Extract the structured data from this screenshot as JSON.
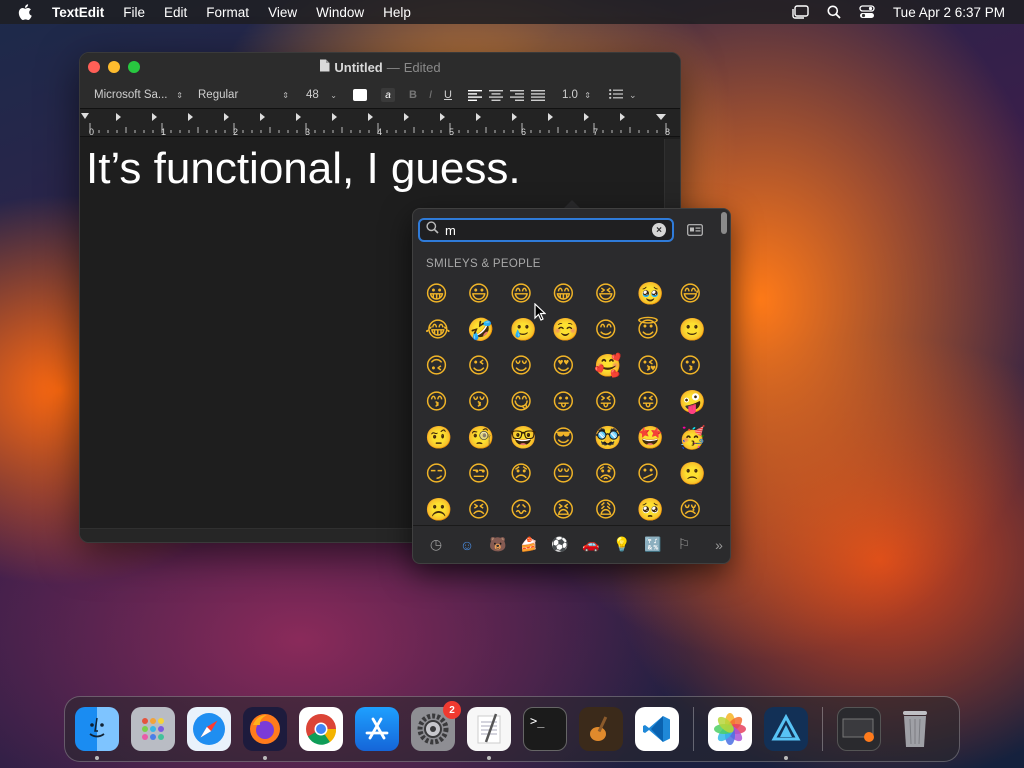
{
  "menubar": {
    "app_name": "TextEdit",
    "items": [
      "File",
      "Edit",
      "Format",
      "View",
      "Window",
      "Help"
    ],
    "clock": "Tue Apr 2  6:37 PM"
  },
  "window": {
    "title": "Untitled",
    "separator": "—",
    "status": "Edited",
    "toolbar": {
      "font": "Microsoft Sa...",
      "style": "Regular",
      "size": "48",
      "bold": "B",
      "italic": "I",
      "underline": "U",
      "highlight": "a",
      "line_spacing": "1.0"
    },
    "ruler_labels": [
      "0",
      "1",
      "2",
      "3",
      "4",
      "5",
      "6",
      "7",
      "8"
    ],
    "document_text": "It’s functional, I guess."
  },
  "picker": {
    "search_value": "m",
    "category_title": "SMILEYS & PEOPLE",
    "emojis": [
      "😀",
      "😃",
      "😄",
      "😁",
      "😆",
      "🥹",
      "😅",
      "😂",
      "🤣",
      "🥲",
      "☺️",
      "😊",
      "😇",
      "🙂",
      "🙃",
      "😉",
      "😌",
      "😍",
      "🥰",
      "😘",
      "😗",
      "😙",
      "😚",
      "😋",
      "😛",
      "😝",
      "😜",
      "🤪",
      "🤨",
      "🧐",
      "🤓",
      "😎",
      "🥸",
      "🤩",
      "🥳",
      "😏",
      "😒",
      "😞",
      "😔",
      "😟",
      "😕",
      "🙁",
      "☹️",
      "😣",
      "😖",
      "😫",
      "😩",
      "🥺",
      "😢"
    ],
    "footer_tabs": [
      {
        "name": "recent",
        "glyph": "◷"
      },
      {
        "name": "smileys",
        "glyph": "☺"
      },
      {
        "name": "animals",
        "glyph": "🐻"
      },
      {
        "name": "food",
        "glyph": "🍰"
      },
      {
        "name": "activity",
        "glyph": "⚽"
      },
      {
        "name": "travel",
        "glyph": "🚗"
      },
      {
        "name": "objects",
        "glyph": "💡"
      },
      {
        "name": "symbols",
        "glyph": "🔣"
      },
      {
        "name": "flags",
        "glyph": "⚐"
      },
      {
        "name": "more",
        "glyph": "»"
      }
    ]
  },
  "dock": {
    "settings_badge": "2",
    "terminal_prompt": ">_"
  },
  "colors": {
    "accent": "#2f7bd9",
    "close": "#ff5f57",
    "minimize": "#febc2e",
    "maximize": "#28c840"
  }
}
